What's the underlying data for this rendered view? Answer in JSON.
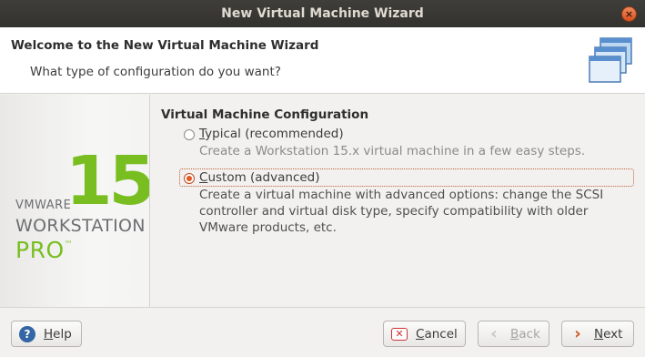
{
  "window": {
    "title": "New Virtual Machine Wizard",
    "close_glyph": "×"
  },
  "header": {
    "title": "Welcome to the New Virtual Machine Wizard",
    "subtitle": "What type of configuration do you want?",
    "icon": "stacked-windows-icon"
  },
  "branding": {
    "number": "15",
    "vendor": "VMWARE",
    "product": "WORKSTATION",
    "edition": "PRO",
    "trademark": "™"
  },
  "config": {
    "section_title": "Virtual Machine Configuration",
    "options": [
      {
        "mnemonic": "T",
        "label_rest": "ypical (recommended)",
        "description": "Create a Workstation 15.x virtual machine in a few easy steps.",
        "selected": false
      },
      {
        "mnemonic": "C",
        "label_rest": "ustom (advanced)",
        "description": "Create a virtual machine with advanced options: change the SCSI controller and virtual disk type, specify compatibility with older VMware products, etc.",
        "selected": true
      }
    ]
  },
  "footer": {
    "help": {
      "mnemonic": "H",
      "rest": "elp",
      "icon": "help-icon"
    },
    "cancel": {
      "mnemonic": "C",
      "rest": "ancel",
      "icon": "cancel-icon"
    },
    "back": {
      "mnemonic": "B",
      "rest": "ack",
      "icon": "back-arrow-icon",
      "enabled": false
    },
    "next": {
      "mnemonic": "N",
      "rest": "ext",
      "icon": "next-arrow-icon"
    }
  }
}
